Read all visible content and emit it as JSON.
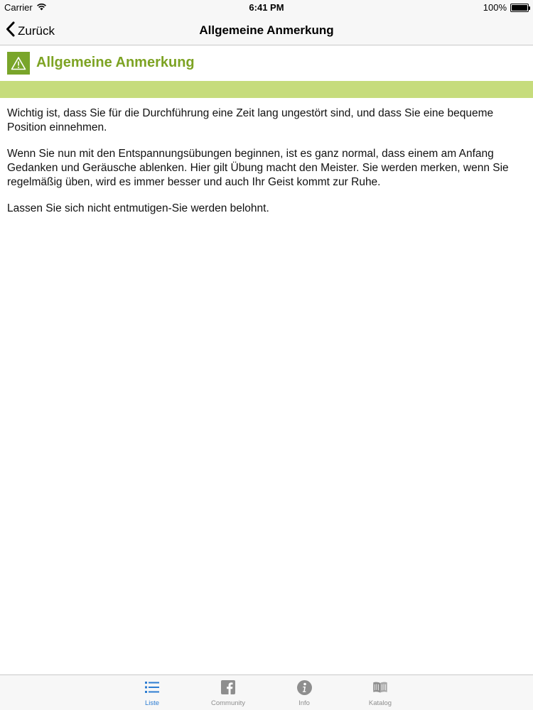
{
  "status_bar": {
    "carrier": "Carrier",
    "time": "6:41 PM",
    "battery": "100%",
    "battery_level": 1.0
  },
  "nav": {
    "back_label": "Zurück",
    "title": "Allgemeine Anmerkung"
  },
  "section": {
    "icon": "warning-icon",
    "title": "Allgemeine Anmerkung",
    "accent_color": "#79a52a",
    "strip_color": "#c6dc7c"
  },
  "content": {
    "paragraphs": [
      "Wichtig ist, dass Sie für die Durchführung eine Zeit lang ungestört sind, und dass Sie eine bequeme Position einnehmen.",
      "Wenn Sie nun mit den Entspannungsübungen beginnen, ist es ganz normal, dass einem am Anfang Gedanken und Geräusche ablenken. Hier gilt Übung macht den Meister. Sie werden merken, wenn Sie regelmäßig üben, wird es immer besser und auch Ihr Geist kommt zur Ruhe.",
      "Lassen Sie sich nicht entmutigen-Sie werden belohnt."
    ]
  },
  "tab_bar": {
    "active_color": "#2d7dd2",
    "tabs": [
      {
        "label": "Liste",
        "icon": "list-icon",
        "active": true
      },
      {
        "label": "Community",
        "icon": "facebook-icon",
        "active": false
      },
      {
        "label": "Info",
        "icon": "info-icon",
        "active": false
      },
      {
        "label": "Katalog",
        "icon": "book-icon",
        "active": false
      }
    ]
  }
}
